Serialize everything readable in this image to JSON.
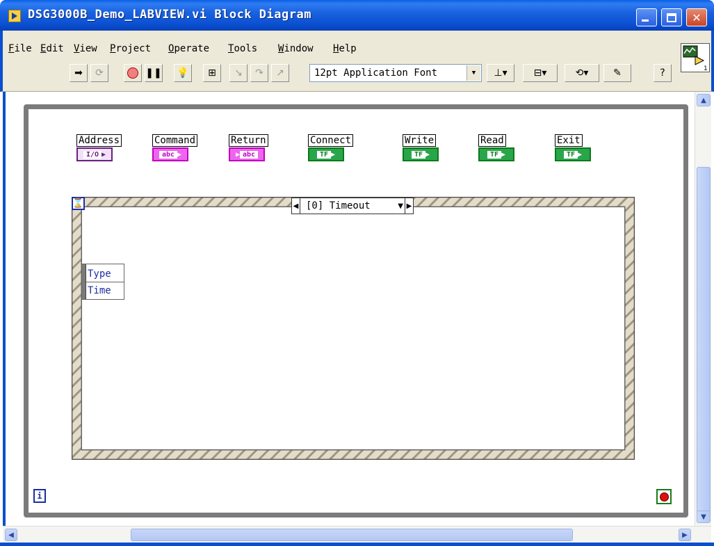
{
  "window": {
    "title": "DSG3000B_Demo_LABVIEW.vi Block Diagram",
    "buttons": {
      "minimize": "minimize",
      "maximize": "maximize",
      "close": "✕"
    }
  },
  "menu": [
    {
      "label": "File",
      "accel": "F",
      "rest": "ile"
    },
    {
      "label": "Edit",
      "accel": "E",
      "rest": "dit"
    },
    {
      "label": "View",
      "accel": "V",
      "rest": "iew"
    },
    {
      "label": "Project",
      "accel": "P",
      "rest": "roject"
    },
    {
      "label": "Operate",
      "accel": "O",
      "rest": "perate"
    },
    {
      "label": "Tools",
      "accel": "T",
      "rest": "ools"
    },
    {
      "label": "Window",
      "accel": "W",
      "rest": "indow"
    },
    {
      "label": "Help",
      "accel": "H",
      "rest": "elp"
    }
  ],
  "toolbar": {
    "font_select": "12pt Application Font",
    "icons": [
      "run-arrow-icon",
      "run-continuous-icon",
      "abort-icon",
      "pause-icon",
      "highlight-execution-icon",
      "retain-wire-values-icon",
      "step-into-icon",
      "step-over-icon",
      "step-out-icon",
      "align-objects-icon",
      "distribute-objects-icon",
      "reorder-icon",
      "cleanup-diagram-icon",
      "context-help-icon"
    ]
  },
  "diagram": {
    "terminals": [
      {
        "label": "Address",
        "type": "I/O",
        "kind": "io"
      },
      {
        "label": "Command",
        "type": "abc",
        "kind": "str"
      },
      {
        "label": "Return",
        "type": "abc",
        "kind": "str"
      },
      {
        "label": "Connect",
        "type": "TF",
        "kind": "bool"
      },
      {
        "label": "Write",
        "type": "TF",
        "kind": "bool"
      },
      {
        "label": "Read",
        "type": "TF",
        "kind": "bool"
      },
      {
        "label": "Exit",
        "type": "TF",
        "kind": "bool"
      }
    ],
    "event_case": "[0] Timeout",
    "event_data": {
      "row1": "Type",
      "row2": "Time"
    },
    "loop_iteration": "i"
  },
  "colors": {
    "titlebar": "#0a4fd0",
    "chrome": "#ece9d8",
    "io_terminal": "#6b1f80",
    "string_terminal": "#c000c0",
    "boolean_terminal": "#0a7a1a",
    "loop_border": "#7b7b7b"
  }
}
